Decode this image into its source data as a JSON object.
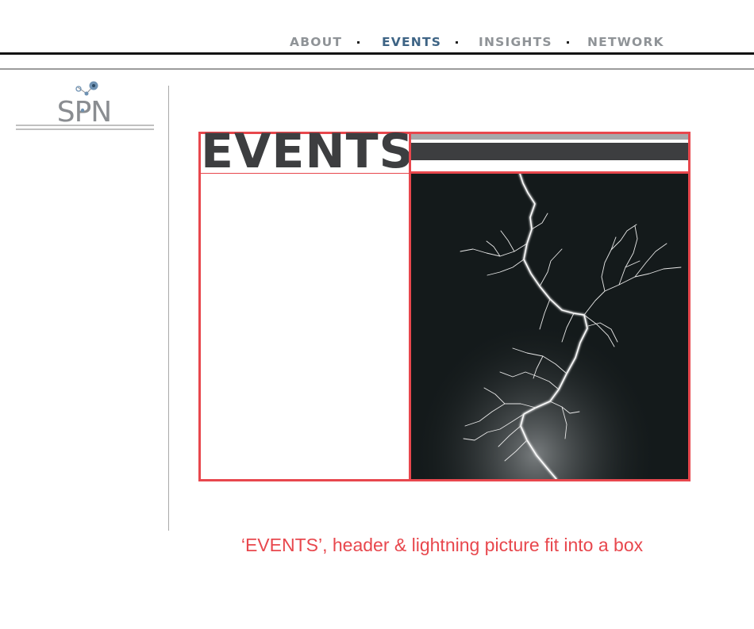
{
  "nav": {
    "items": [
      {
        "label": "ABOUT",
        "active": false
      },
      {
        "label": "EVENTS",
        "active": true
      },
      {
        "label": "INSIGHTS",
        "active": false
      },
      {
        "label": "NETWORK",
        "active": false
      }
    ]
  },
  "logo": {
    "text": "SPN"
  },
  "events_box": {
    "title": "EVENTS",
    "image_icon": "lightning-photo"
  },
  "caption": "‘EVENTS’, header & lightning picture fit into a box",
  "colors": {
    "accent": "#e8474d",
    "nav_active": "#3e6485",
    "nav_inactive": "#8f9397",
    "header_dark": "#3d3e40",
    "header_light": "#a7a8aa",
    "logo_blue": "#6f92b3"
  }
}
